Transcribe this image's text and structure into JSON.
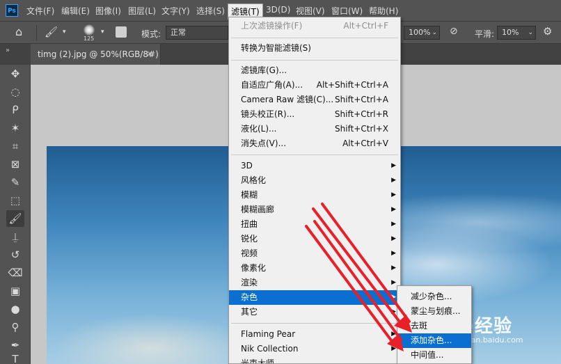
{
  "app": {
    "logo_text": "Ps"
  },
  "menubar": {
    "items": [
      "文件(F)",
      "编辑(E)",
      "图像(I)",
      "图层(L)",
      "文字(Y)",
      "选择(S)",
      "滤镜(T)",
      "3D(D)",
      "视图(V)",
      "窗口(W)",
      "帮助(H)"
    ],
    "active_index": 6
  },
  "options_bar": {
    "brush_size": "125",
    "mode_label": "模式:",
    "mode_value": "正常",
    "opacity_value": "100%",
    "smoothing_label": "平滑:",
    "smoothing_value": "10%"
  },
  "document_tab": {
    "title": "timg (2).jpg @ 50%(RGB/8#)",
    "close_glyph": "×"
  },
  "filter_menu": {
    "items": [
      {
        "label": "上次滤镜操作(F)",
        "shortcut": "Alt+Ctrl+F",
        "disabled": true
      },
      {
        "separator": true
      },
      {
        "label": "转换为智能滤镜(S)"
      },
      {
        "separator": true
      },
      {
        "label": "滤镜库(G)..."
      },
      {
        "label": "自适应广角(A)...",
        "shortcut": "Alt+Shift+Ctrl+A"
      },
      {
        "label": "Camera Raw 滤镜(C)...",
        "shortcut": "Shift+Ctrl+A"
      },
      {
        "label": "镜头校正(R)...",
        "shortcut": "Shift+Ctrl+R"
      },
      {
        "label": "液化(L)...",
        "shortcut": "Shift+Ctrl+X"
      },
      {
        "label": "消失点(V)...",
        "shortcut": "Alt+Ctrl+V"
      },
      {
        "separator": true
      },
      {
        "label": "3D",
        "submenu": true
      },
      {
        "label": "风格化",
        "submenu": true
      },
      {
        "label": "模糊",
        "submenu": true
      },
      {
        "label": "模糊画廊",
        "submenu": true
      },
      {
        "label": "扭曲",
        "submenu": true
      },
      {
        "label": "锐化",
        "submenu": true
      },
      {
        "label": "视频",
        "submenu": true
      },
      {
        "label": "像素化",
        "submenu": true
      },
      {
        "label": "渲染",
        "submenu": true
      },
      {
        "label": "杂色",
        "submenu": true,
        "highlighted": true
      },
      {
        "label": "其它",
        "submenu": true
      },
      {
        "separator": true
      },
      {
        "label": "Flaming Pear",
        "submenu": true
      },
      {
        "label": "Nik Collection",
        "submenu": true
      },
      {
        "label": "光束大师",
        "submenu": true
      }
    ]
  },
  "noise_submenu": {
    "items": [
      {
        "label": "减少杂色..."
      },
      {
        "label": "蒙尘与划痕..."
      },
      {
        "label": "去斑"
      },
      {
        "label": "添加杂色...",
        "highlighted": true
      },
      {
        "label": "中间值..."
      }
    ]
  },
  "watermark": {
    "brand": "Bai⊚经验",
    "url": "jingyan.baidu.com"
  },
  "colors": {
    "menu_highlight": "#0a6fd0",
    "annotation_arrow": "#e8202a",
    "chrome_dark": "#535353"
  }
}
